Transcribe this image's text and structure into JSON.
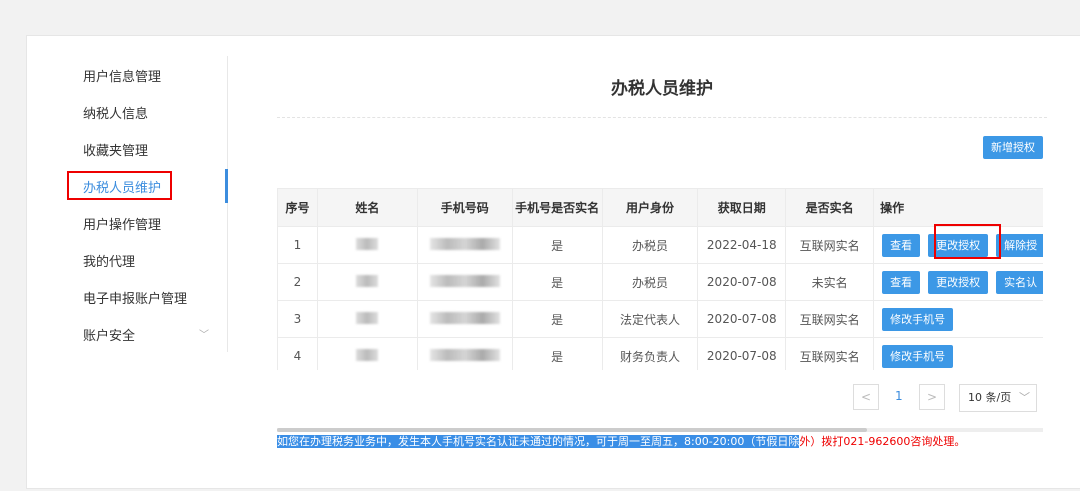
{
  "sidebar": {
    "items": [
      {
        "label": "用户信息管理"
      },
      {
        "label": "纳税人信息"
      },
      {
        "label": "收藏夹管理"
      },
      {
        "label": "办税人员维护"
      },
      {
        "label": "用户操作管理"
      },
      {
        "label": "我的代理"
      },
      {
        "label": "电子申报账户管理"
      },
      {
        "label": "账户安全"
      }
    ],
    "active": "办税人员维护"
  },
  "page": {
    "title": "办税人员维护",
    "add_button": "新增授权"
  },
  "table": {
    "headers": [
      "序号",
      "姓名",
      "手机号码",
      "手机号是否实名",
      "用户身份",
      "获取日期",
      "是否实名",
      "操作"
    ],
    "rows": [
      {
        "no": "1",
        "verified_phone": "是",
        "identity": "办税员",
        "date": "2022-04-18",
        "realname": "互联网实名",
        "actions": [
          "查看",
          "更改授权",
          "解除授"
        ]
      },
      {
        "no": "2",
        "verified_phone": "是",
        "identity": "办税员",
        "date": "2020-07-08",
        "realname": "未实名",
        "actions": [
          "查看",
          "更改授权",
          "实名认"
        ]
      },
      {
        "no": "3",
        "verified_phone": "是",
        "identity": "法定代表人",
        "date": "2020-07-08",
        "realname": "互联网实名",
        "actions": [
          "修改手机号"
        ]
      },
      {
        "no": "4",
        "verified_phone": "是",
        "identity": "财务负责人",
        "date": "2020-07-08",
        "realname": "互联网实名",
        "actions": [
          "修改手机号"
        ]
      }
    ]
  },
  "pagination": {
    "prev": "<",
    "current": "1",
    "next": ">",
    "page_size": "10 条/页"
  },
  "notice": {
    "selected": "如您在办理税务业务中，发生本人手机号实名认证未通过的情况，可于周一至周五，8:00-20:00（节假日除",
    "rest": "外）拨打021-962600咨询处理。"
  },
  "colors": {
    "accent": "#3c98e6",
    "highlight": "#ee0000"
  }
}
